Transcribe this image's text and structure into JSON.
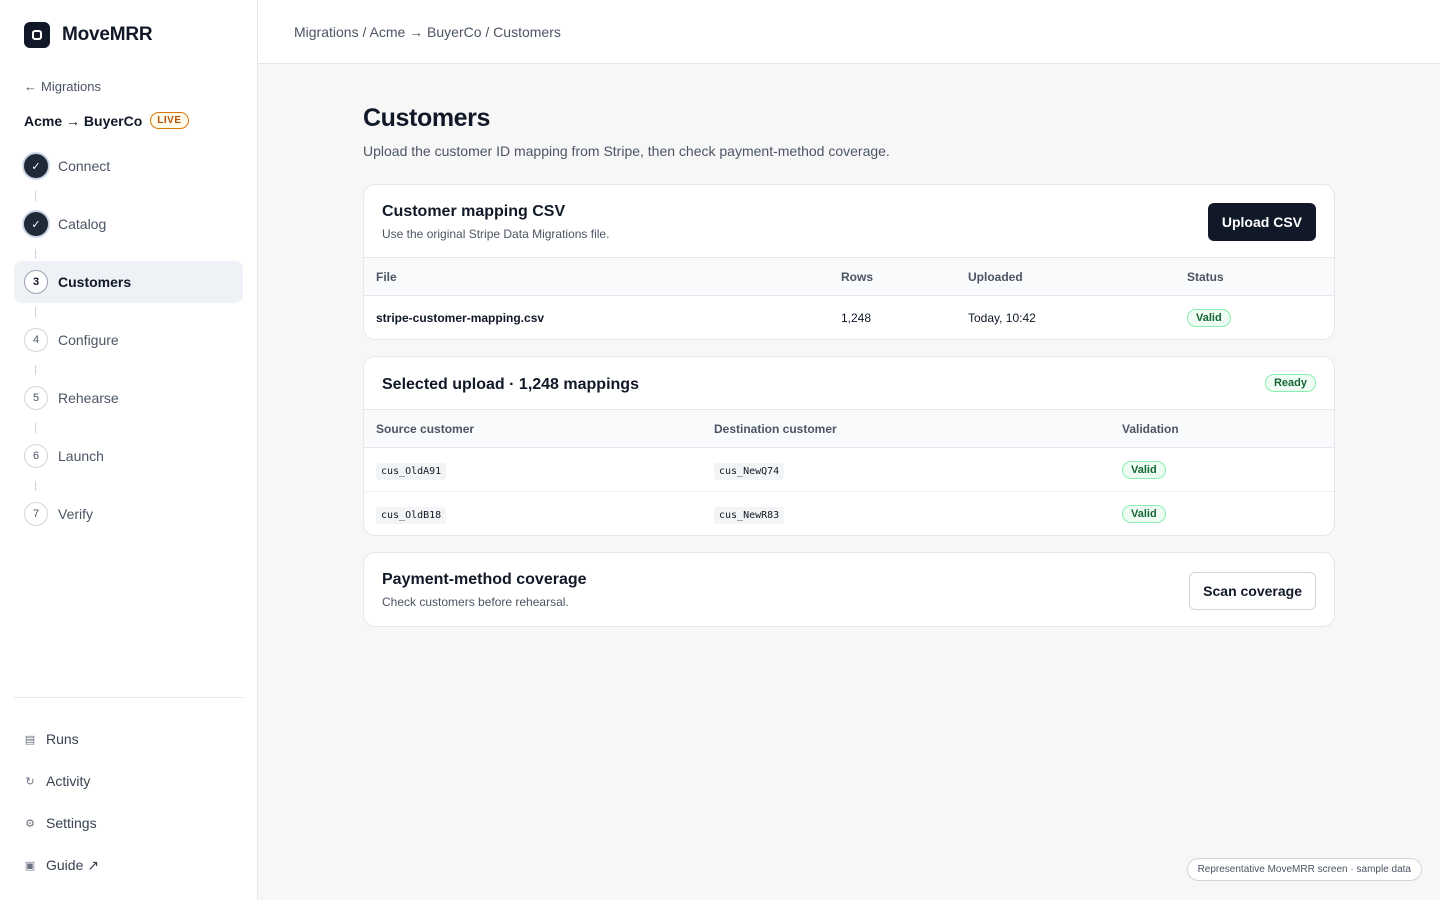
{
  "app": {
    "name": "MoveMRR"
  },
  "sidebar": {
    "back_label": "Migrations",
    "back_arrow": "←",
    "migration_name": "Acme → BuyerCo",
    "migration_status": "LIVE",
    "steps": [
      {
        "label": "Connect",
        "marker": "✓",
        "state": "done"
      },
      {
        "label": "Catalog",
        "marker": "✓",
        "state": "done"
      },
      {
        "label": "Customers",
        "marker": "3",
        "state": "current"
      },
      {
        "label": "Configure",
        "marker": "4",
        "state": "todo"
      },
      {
        "label": "Rehearse",
        "marker": "5",
        "state": "todo"
      },
      {
        "label": "Launch",
        "marker": "6",
        "state": "todo"
      },
      {
        "label": "Verify",
        "marker": "7",
        "state": "todo"
      }
    ],
    "bottom_nav": [
      {
        "label": "Runs",
        "icon": "list-icon",
        "glyph": "▤"
      },
      {
        "label": "Activity",
        "icon": "refresh-icon",
        "glyph": "↻"
      },
      {
        "label": "Settings",
        "icon": "gear-icon",
        "glyph": "⚙"
      },
      {
        "label": "Guide ↗",
        "icon": "book-icon",
        "glyph": "▣"
      }
    ]
  },
  "topbar": {
    "breadcrumb": "Migrations / Acme → BuyerCo / Customers"
  },
  "page": {
    "title": "Customers",
    "subtitle": "Upload the customer ID mapping from Stripe, then check payment-method coverage."
  },
  "mapping_card": {
    "title": "Customer mapping CSV",
    "description": "Use the original Stripe Data Migrations file.",
    "button": "Upload CSV",
    "columns": [
      "File",
      "Rows",
      "Uploaded",
      "Status"
    ],
    "rows": [
      {
        "file": "stripe-customer-mapping.csv",
        "rows": "1,248",
        "uploaded": "Today, 10:42",
        "status": "Valid"
      }
    ]
  },
  "selected_card": {
    "title": "Selected upload · 1,248 mappings",
    "badge": "Ready",
    "columns": [
      "Source customer",
      "Destination customer",
      "Validation"
    ],
    "rows": [
      {
        "source": "cus_OldA91",
        "destination": "cus_NewQ74",
        "validation": "Valid"
      },
      {
        "source": "cus_OldB18",
        "destination": "cus_NewR83",
        "validation": "Valid"
      }
    ]
  },
  "coverage_card": {
    "title": "Payment-method coverage",
    "description": "Check customers before rehearsal.",
    "button": "Scan coverage"
  },
  "footer_note": "Representative MoveMRR screen · sample data",
  "colors": {
    "accent": "#111827",
    "valid": "#166534",
    "live": "#b45309"
  }
}
